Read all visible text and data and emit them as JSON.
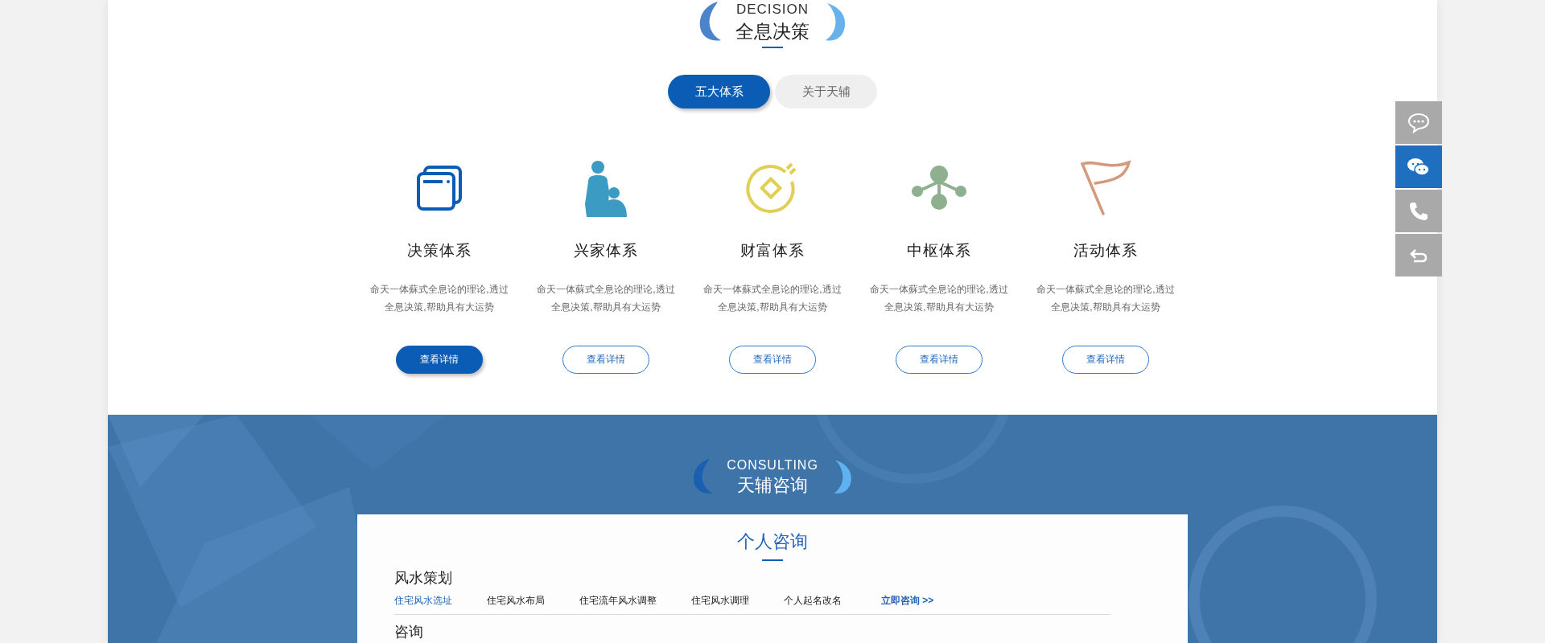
{
  "decision": {
    "subtitle": "DECISION",
    "title": "全息决策"
  },
  "tabs": [
    {
      "label": "五大体系",
      "selected": true
    },
    {
      "label": "关于天辅",
      "selected": false
    }
  ],
  "systems": [
    {
      "title": "决策体系",
      "lines": [
        "命天一体蘇式全息论的理论,透过",
        "全息决策,帮助具有大运势"
      ],
      "button": "查看详情",
      "selected": true
    },
    {
      "title": "兴家体系",
      "lines": [
        "命天一体蘇式全息论的理论,透过",
        "全息决策,帮助具有大运势"
      ],
      "button": "查看详情",
      "selected": false
    },
    {
      "title": "财富体系",
      "lines": [
        "命天一体蘇式全息论的理论,透过",
        "全息决策,帮助具有大运势"
      ],
      "button": "查看详情",
      "selected": false
    },
    {
      "title": "中枢体系",
      "lines": [
        "命天一体蘇式全息论的理论,透过",
        "全息决策,帮助具有大运势"
      ],
      "button": "查看详情",
      "selected": false
    },
    {
      "title": "活动体系",
      "lines": [
        "命天一体蘇式全息论的理论,透过",
        "全息决策,帮助具有大运势"
      ],
      "button": "查看详情",
      "selected": false
    }
  ],
  "sidebar": [
    {
      "selected": false
    },
    {
      "selected": true
    },
    {
      "selected": false
    },
    {
      "selected": false
    }
  ],
  "consulting": {
    "subtitle": "CONSULTING",
    "title": "天辅咨询",
    "card": {
      "title": "个人咨询",
      "groups": [
        {
          "heading": "风水策划",
          "links": [
            {
              "label": "住宅风水选址",
              "kind": "item",
              "selected": true
            },
            {
              "label": "住宅风水布局",
              "kind": "item",
              "selected": false
            },
            {
              "label": "住宅流年风水调整",
              "kind": "item",
              "selected": false
            },
            {
              "label": "住宅风水调理",
              "kind": "item",
              "selected": false
            },
            {
              "label": "个人起名改名",
              "kind": "item",
              "selected": false
            },
            {
              "label": "立即咨询 >>",
              "kind": "more"
            }
          ]
        },
        {
          "heading": "咨询"
        }
      ]
    }
  }
}
